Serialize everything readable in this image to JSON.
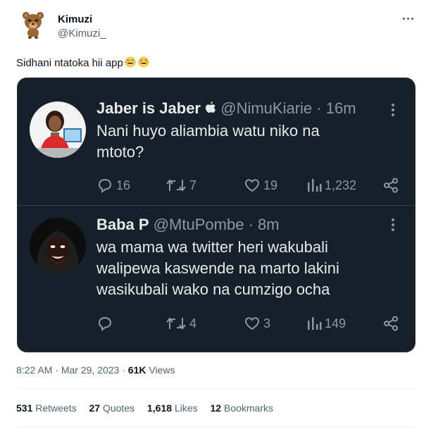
{
  "tweet": {
    "author_name": "Kimuzi",
    "author_handle": "@Kimuzi_",
    "text": "Sidhani ntatoka hii app",
    "emojis": [
      "face-with-tears-of-joy",
      "face-with-tears-of-joy"
    ],
    "time": "8:22 AM",
    "dot": "·",
    "date": "Mar 29, 2023",
    "views_count": "61K",
    "views_label": "Views",
    "stats": [
      {
        "count": "531",
        "label": "Retweets"
      },
      {
        "count": "27",
        "label": "Quotes"
      },
      {
        "count": "1,618",
        "label": "Likes"
      },
      {
        "count": "12",
        "label": "Bookmarks"
      }
    ]
  },
  "embedded": {
    "first": {
      "name": "Jaber is Jaber",
      "badge_icon": "apple-icon",
      "handle": "@NimuKiarie",
      "time": "· 16m",
      "lines": [
        "Nani huyo aliambia watu niko na",
        "mtoto?"
      ],
      "replies": "16",
      "retweets": "7",
      "likes": "19",
      "views": "1,232"
    },
    "second": {
      "name": "Baba P",
      "handle": "@MtuPombe",
      "time": "· 8m",
      "lines": [
        "wa mama wa twitter heri wakubali",
        "walipewa kaswende na marto lakini",
        "wasikubali wako na cumzigo ocha"
      ],
      "replies": "",
      "retweets": "4",
      "likes": "3",
      "views": "149"
    }
  },
  "colors": {
    "dark_bg": "#15202b",
    "dark_text": "#e7e9ea",
    "dark_muted": "#8b98a5",
    "light_muted": "#536471"
  }
}
